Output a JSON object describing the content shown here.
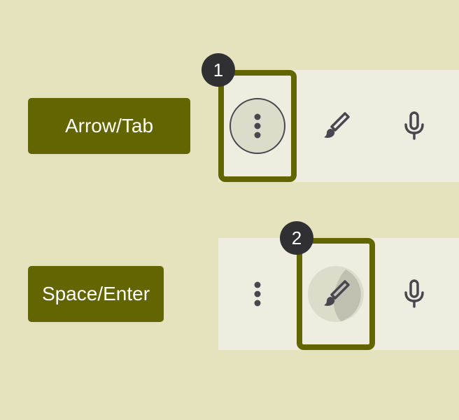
{
  "rows": [
    {
      "key_label": "Arrow/Tab",
      "step_number": "1",
      "focused_tool": "more-options",
      "tools": [
        "more-vert-icon",
        "brush-icon",
        "mic-icon"
      ]
    },
    {
      "key_label": "Space/Enter",
      "step_number": "2",
      "focused_tool": "brush",
      "tools": [
        "more-vert-icon",
        "brush-icon",
        "mic-icon"
      ]
    }
  ],
  "colors": {
    "background": "#e5e3be",
    "accent": "#636500",
    "toolbar": "#efede0",
    "badge": "#303033",
    "icon": "#4a4650"
  }
}
